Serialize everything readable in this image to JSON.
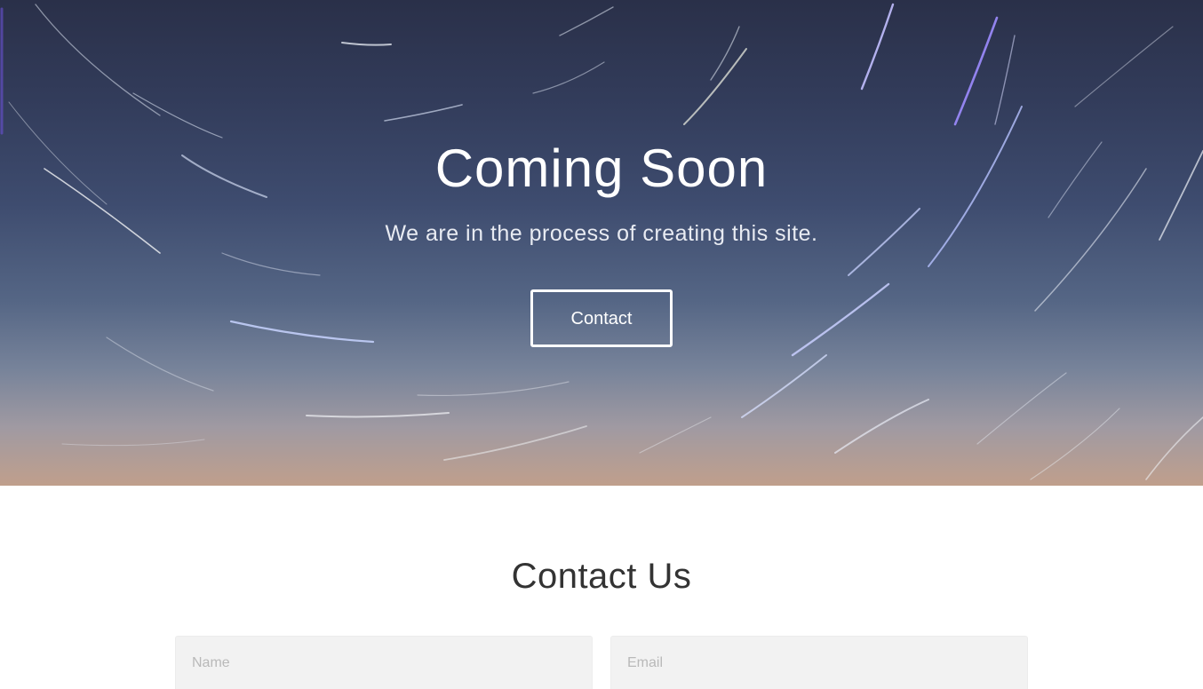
{
  "hero": {
    "title": "Coming Soon",
    "subtitle": "We are in the process of creating this site.",
    "button_label": "Contact",
    "background_colors": [
      "#2a3049",
      "#3e4c6f",
      "#77839a",
      "#c09f8c"
    ]
  },
  "contact": {
    "title": "Contact Us",
    "name_placeholder": "Name",
    "email_placeholder": "Email"
  }
}
